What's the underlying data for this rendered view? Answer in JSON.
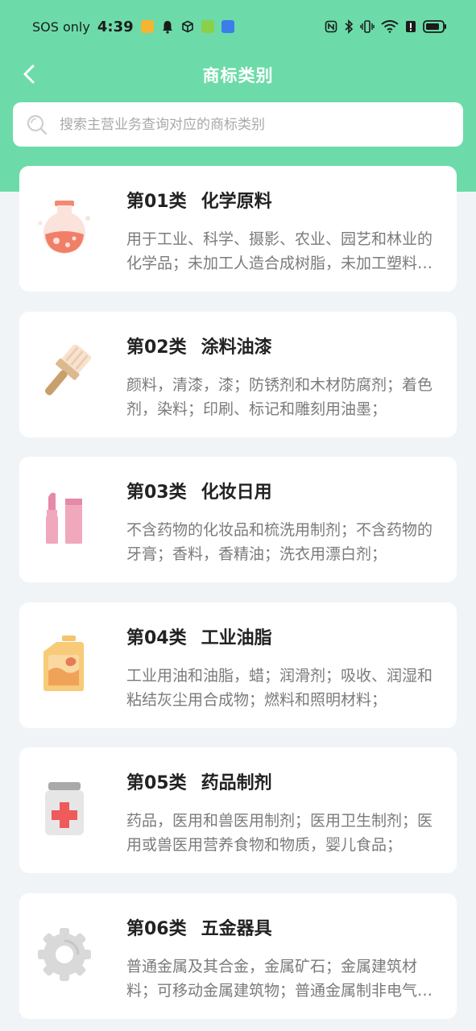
{
  "status_bar": {
    "carrier": "SOS only",
    "time": "4:39"
  },
  "header": {
    "title": "商标类别"
  },
  "search": {
    "placeholder": "搜索主营业务查询对应的商标类别",
    "value": ""
  },
  "categories": [
    {
      "code": "第01类",
      "name": "化学原料",
      "desc": "用于工业、科学、摄影、农业、园艺和林业的化学品；未加工人造合成树脂，未加工塑料物质；",
      "icon": "flask-icon"
    },
    {
      "code": "第02类",
      "name": "涂料油漆",
      "desc": "颜料，清漆，漆；防锈剂和木材防腐剂；着色剂，染料；印刷、标记和雕刻用油墨；",
      "icon": "paintbrush-icon"
    },
    {
      "code": "第03类",
      "name": "化妆日用",
      "desc": "不含药物的化妆品和梳洗用制剂；不含药物的牙膏；香料，香精油；洗衣用漂白剂；",
      "icon": "lipstick-icon"
    },
    {
      "code": "第04类",
      "name": "工业油脂",
      "desc": "工业用油和油脂，蜡；润滑剂；吸收、润湿和粘结灰尘用合成物；燃料和照明材料；",
      "icon": "oil-can-icon"
    },
    {
      "code": "第05类",
      "name": "药品制剂",
      "desc": "药品，医用和兽医用制剂；医用卫生制剂；医用或兽医用营养食物和物质，婴儿食品；",
      "icon": "medicine-jar-icon"
    },
    {
      "code": "第06类",
      "name": "五金器具",
      "desc": "普通金属及其合金，金属矿石；金属建筑材料；可移动金属建筑物；普通金属制非电气用缆线；",
      "icon": "gear-icon"
    }
  ]
}
